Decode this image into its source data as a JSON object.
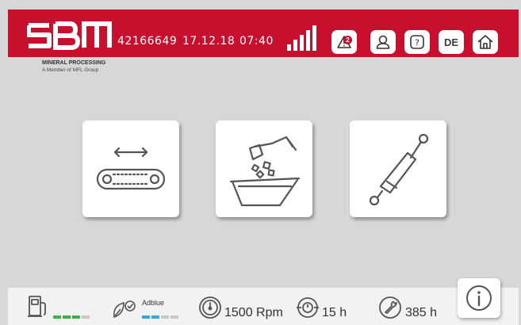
{
  "header": {
    "logo_text": "SBM",
    "machine_id": "42166649",
    "date": "17.12.18",
    "time": "07:40",
    "alert_count": "2",
    "language": "DE",
    "brand_color": "#c8102e"
  },
  "branding": {
    "line1": "MINERAL PROCESSING",
    "line2": "A Member of MFL Group"
  },
  "tiles": [
    {
      "name": "conveyor",
      "icon": "conveyor-belt-icon"
    },
    {
      "name": "crusher",
      "icon": "crusher-hopper-icon"
    },
    {
      "name": "hydraulic",
      "icon": "hydraulic-cylinder-icon"
    }
  ],
  "footer": {
    "fuel_level_segments_filled": 3,
    "fuel_level_segments_total": 4,
    "adblue_label": "Adblue",
    "adblue_level_segments_filled": 2,
    "adblue_level_segments_total": 4,
    "rpm": "1500 Rpm",
    "engine_hours": "15 h",
    "service_hours": "385 h",
    "fuel_color": "#3cb14a",
    "adblue_color": "#3aa7dc"
  }
}
